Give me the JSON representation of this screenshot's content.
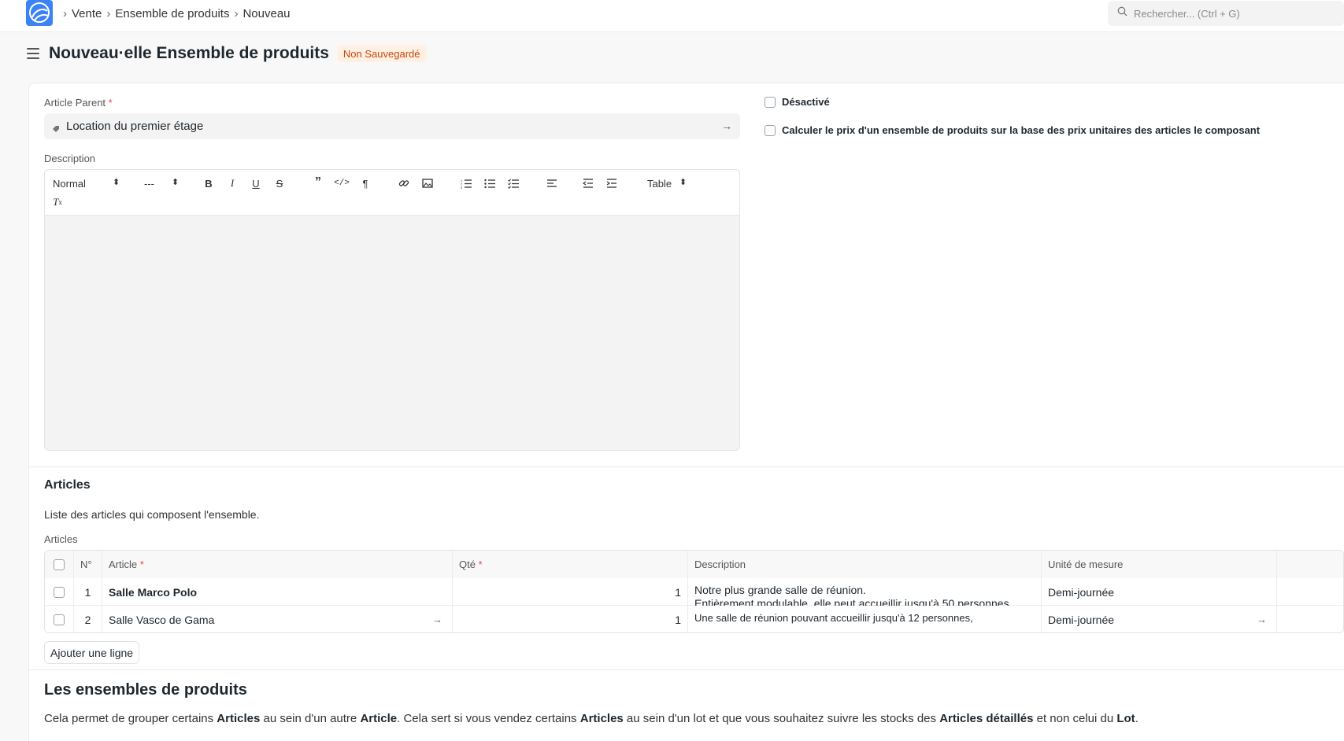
{
  "navbar": {
    "breadcrumbs": [
      "Vente",
      "Ensemble de produits",
      "Nouveau"
    ],
    "search_placeholder": "Rechercher... (Ctrl + G)"
  },
  "page": {
    "title": "Nouveau·elle Ensemble de produits",
    "status": "Non Sauvegardé"
  },
  "form": {
    "parent_label": "Article Parent",
    "parent_required": "*",
    "parent_value": "Location du premier étage",
    "description_label": "Description",
    "disabled_label": "Désactivé",
    "calc_label": "Calculer le prix d'un ensemble de produits sur la base des prix unitaires des articles le composant"
  },
  "toolbar": {
    "style_select": "Normal",
    "size_select": "---",
    "table_select": "Table"
  },
  "articles": {
    "section_title": "Articles",
    "section_desc": "Liste des articles qui composent l'ensemble.",
    "grid_label": "Articles",
    "columns": {
      "no": "N°",
      "article": "Article",
      "qty": "Qté",
      "description": "Description",
      "uom": "Unité de mesure"
    },
    "required_mark": "*",
    "rows": [
      {
        "no": "1",
        "article": "Salle Marco Polo",
        "qty": "1",
        "desc_line1": "Notre plus grande salle de réunion.",
        "desc_line2": "Entièrement modulable, elle peut accueillir jusqu'à 50 personnes",
        "uom": "Demi-journée"
      },
      {
        "no": "2",
        "article": "Salle Vasco de Gama",
        "qty": "1",
        "desc_line1": "Une salle de réunion pouvant accueillir jusqu'à 12 personnes,",
        "uom": "Demi-journée"
      }
    ],
    "add_row": "Ajouter une ligne"
  },
  "help": {
    "title": "Les ensembles de produits",
    "p1_a": "Cela permet de grouper certains ",
    "p1_b": "Articles",
    "p1_c": " au sein d'un autre ",
    "p1_d": "Article",
    "p1_e": ". Cela sert si vous vendez certains ",
    "p1_f": "Articles",
    "p1_g": " au sein d'un lot et que vous souhaitez suivre les stocks des ",
    "p1_h": "Articles détaillés",
    "p1_i": " et non celui du ",
    "p1_j": "Lot",
    "p1_k": "."
  },
  "colors": {
    "accent": "#3b82f6",
    "badge_bg": "#fff0e3",
    "badge_text": "#c5490a"
  }
}
